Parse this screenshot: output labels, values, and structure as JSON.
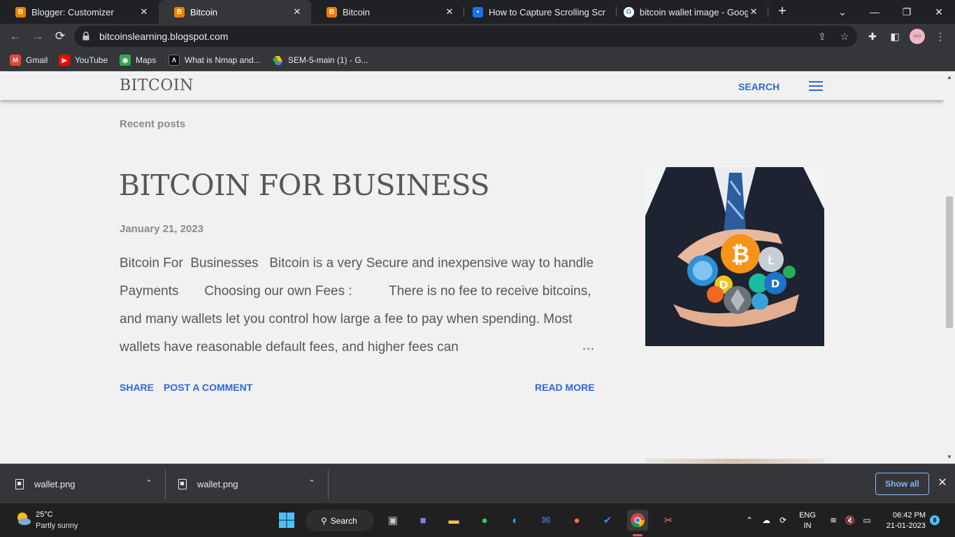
{
  "browser": {
    "tabs": [
      {
        "title": "Blogger: Customizer",
        "icon": "blogger-icon",
        "active": false
      },
      {
        "title": "Bitcoin",
        "icon": "blogger-icon",
        "active": true
      },
      {
        "title": "Bitcoin",
        "icon": "blogger-icon",
        "active": false
      },
      {
        "title": "How to Capture Scrolling Scr",
        "icon": "screenshot-app-icon",
        "active": false
      },
      {
        "title": "bitcoin wallet image - Googl",
        "icon": "google-icon",
        "active": false
      }
    ],
    "url": "bitcoinslearning.blogspot.com",
    "bookmarks": [
      {
        "label": "Gmail",
        "icon": "gmail-icon"
      },
      {
        "label": "YouTube",
        "icon": "youtube-icon"
      },
      {
        "label": "Maps",
        "icon": "maps-icon"
      },
      {
        "label": "What is Nmap and...",
        "icon": "nmap-icon"
      },
      {
        "label": "SEM-5-main (1) - G...",
        "icon": "google-drive-icon"
      }
    ]
  },
  "blog": {
    "title": "BITCOIN",
    "search_label": "SEARCH",
    "section_title": "Recent posts",
    "post": {
      "title": "BITCOIN FOR BUSINESS",
      "date": "January 21, 2023",
      "snippet": "Bitcoin For  Businesses   Bitcoin is a very Secure and inexpensive way to handle Payments       Choosing our own Fees :          There is no fee to receive bitcoins, and many wallets let you control how large a fee to pay when spending. Most wallets have reasonable default fees, and higher fees can",
      "ellipsis": "…",
      "share_label": "SHARE",
      "comment_label": "POST A COMMENT",
      "read_more_label": "READ MORE",
      "image_alt": "businessman holding cryptocurrency coins"
    }
  },
  "downloads": {
    "items": [
      {
        "filename": "wallet.png"
      },
      {
        "filename": "wallet.png"
      }
    ],
    "show_all_label": "Show all"
  },
  "taskbar": {
    "weather_temp": "25°C",
    "weather_desc": "Partly sunny",
    "search_label": "Search",
    "lang_line1": "ENG",
    "lang_line2": "IN",
    "time": "06:42 PM",
    "date": "21-01-2023",
    "notification_count": "8"
  },
  "colors": {
    "accent_link": "#3367d6",
    "page_bg": "#f1f1f1",
    "text": "#575757",
    "muted": "#8b8b8b",
    "chrome_dark": "#202124",
    "chrome_toolbar": "#35363a",
    "bitcoin_orange": "#f7931a"
  }
}
